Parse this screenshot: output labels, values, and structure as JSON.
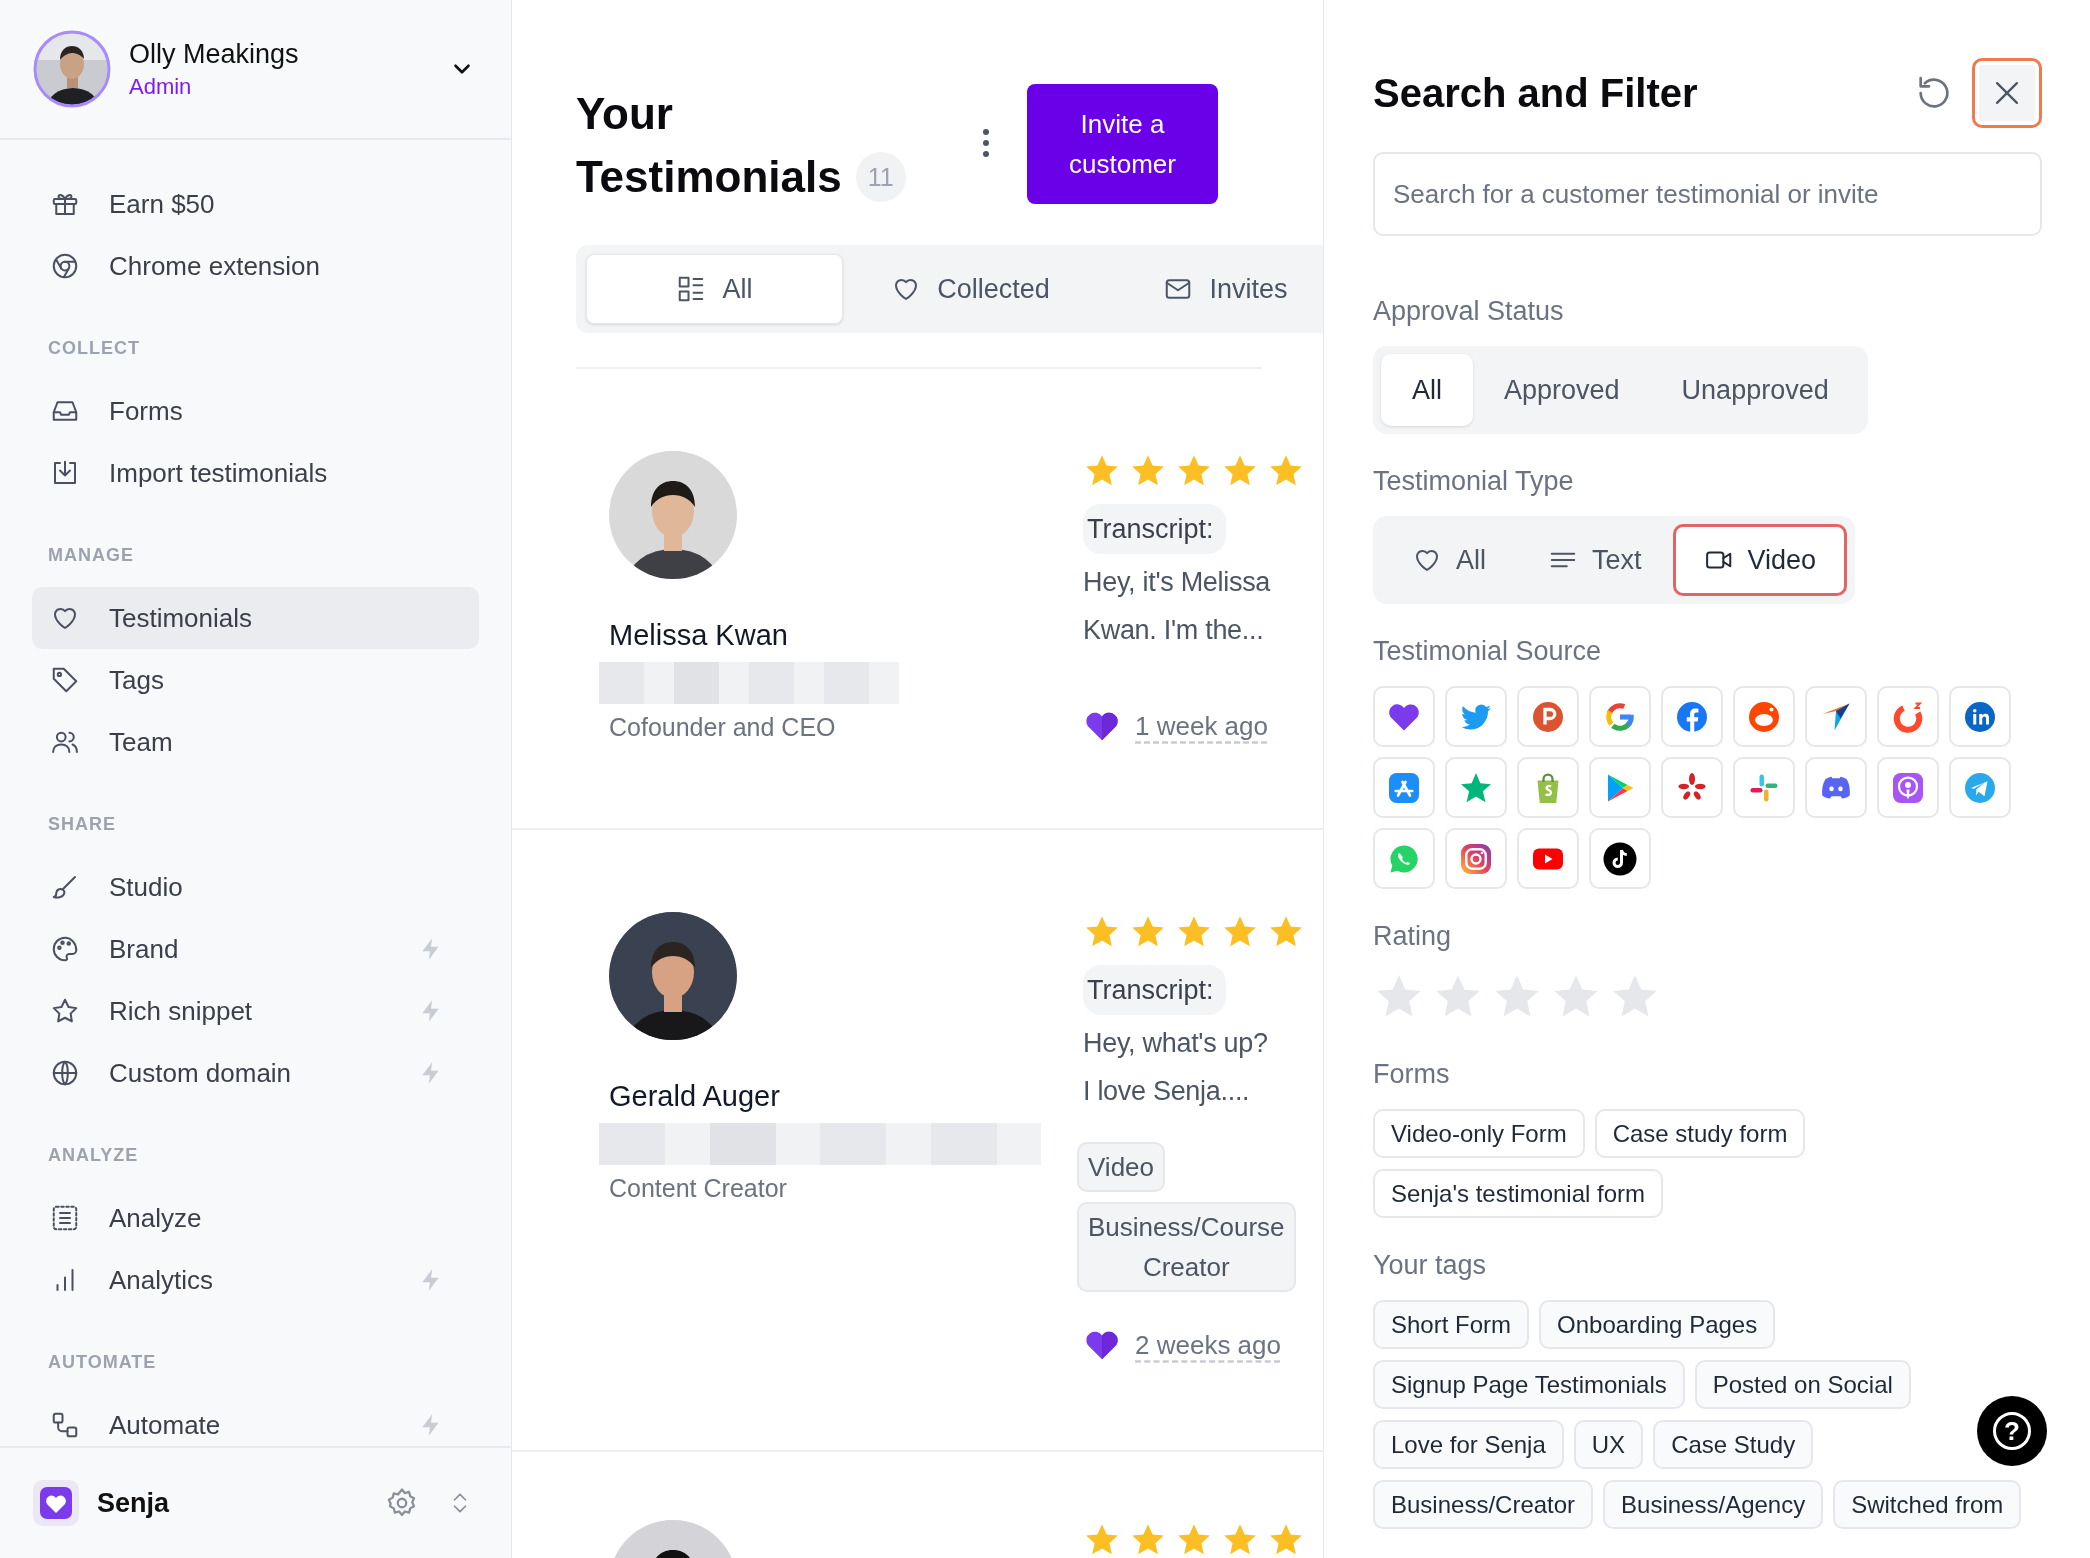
{
  "user": {
    "name": "Olly Meakings",
    "role": "Admin"
  },
  "sidebar": {
    "sections": [
      {
        "items": [
          {
            "label": "Earn $50",
            "selected": false,
            "pro": false
          },
          {
            "label": "Chrome extension",
            "selected": false,
            "pro": false
          }
        ]
      },
      {
        "heading": "COLLECT",
        "items": [
          {
            "label": "Forms",
            "selected": false,
            "pro": false
          },
          {
            "label": "Import testimonials",
            "selected": false,
            "pro": false
          }
        ]
      },
      {
        "heading": "MANAGE",
        "items": [
          {
            "label": "Testimonials",
            "selected": true,
            "pro": false
          },
          {
            "label": "Tags",
            "selected": false,
            "pro": false
          },
          {
            "label": "Team",
            "selected": false,
            "pro": false
          }
        ]
      },
      {
        "heading": "SHARE",
        "items": [
          {
            "label": "Studio",
            "selected": false,
            "pro": false
          },
          {
            "label": "Brand",
            "selected": false,
            "pro": true
          },
          {
            "label": "Rich snippet",
            "selected": false,
            "pro": true
          },
          {
            "label": "Custom domain",
            "selected": false,
            "pro": true
          }
        ]
      },
      {
        "heading": "ANALYZE",
        "items": [
          {
            "label": "Analyze",
            "selected": false,
            "pro": false
          },
          {
            "label": "Analytics",
            "selected": false,
            "pro": true
          }
        ]
      },
      {
        "heading": "AUTOMATE",
        "items": [
          {
            "label": "Automate",
            "selected": false,
            "pro": true
          }
        ]
      }
    ]
  },
  "workspace": {
    "name": "Senja"
  },
  "main": {
    "title": "Your Testimonials",
    "count": "11",
    "invite_button": "Invite a customer",
    "tabs": [
      {
        "label": "All",
        "selected": true
      },
      {
        "label": "Collected",
        "selected": false
      },
      {
        "label": "Invites",
        "selected": false
      }
    ]
  },
  "testimonials": [
    {
      "name": "Melissa Kwan",
      "title": "Cofounder and CEO",
      "stars": 5,
      "label": "Transcript:",
      "excerpt": "Hey, it's Melissa\nKwan. I'm the...",
      "time": "1 week ago"
    },
    {
      "name": "Gerald Auger",
      "title": "Content Creator",
      "stars": 5,
      "label": "Transcript:",
      "excerpt": "Hey, what's up?\nI love Senja....",
      "tags": [
        "Video",
        "Business/Course\nCreator"
      ],
      "time": "2 weeks ago"
    },
    {
      "stars": 5
    }
  ],
  "filter": {
    "title": "Search and Filter",
    "search": {
      "placeholder": "Search for a customer testimonial or invite"
    },
    "approval": {
      "label": "Approval Status",
      "options": [
        {
          "label": "All",
          "selected": true
        },
        {
          "label": "Approved",
          "selected": false
        },
        {
          "label": "Unapproved",
          "selected": false
        }
      ]
    },
    "type": {
      "label": "Testimonial Type",
      "options": [
        {
          "label": "All",
          "selected": false
        },
        {
          "label": "Text",
          "selected": false
        },
        {
          "label": "Video",
          "selected": true
        }
      ]
    },
    "source": {
      "label": "Testimonial Source"
    },
    "rating": {
      "label": "Rating",
      "stars": 0
    },
    "forms": {
      "label": "Forms",
      "items": [
        "Video-only Form",
        "Case study form",
        "Senja's testimonial form"
      ]
    },
    "tags": {
      "label": "Your tags",
      "items": [
        "Short Form",
        "Onboarding Pages",
        "Signup Page Testimonials",
        "Posted on Social",
        "Love for Senja",
        "UX",
        "Case Study",
        "Business/Creator",
        "Business/Agency",
        "Switched from"
      ]
    }
  },
  "help_button": "?"
}
